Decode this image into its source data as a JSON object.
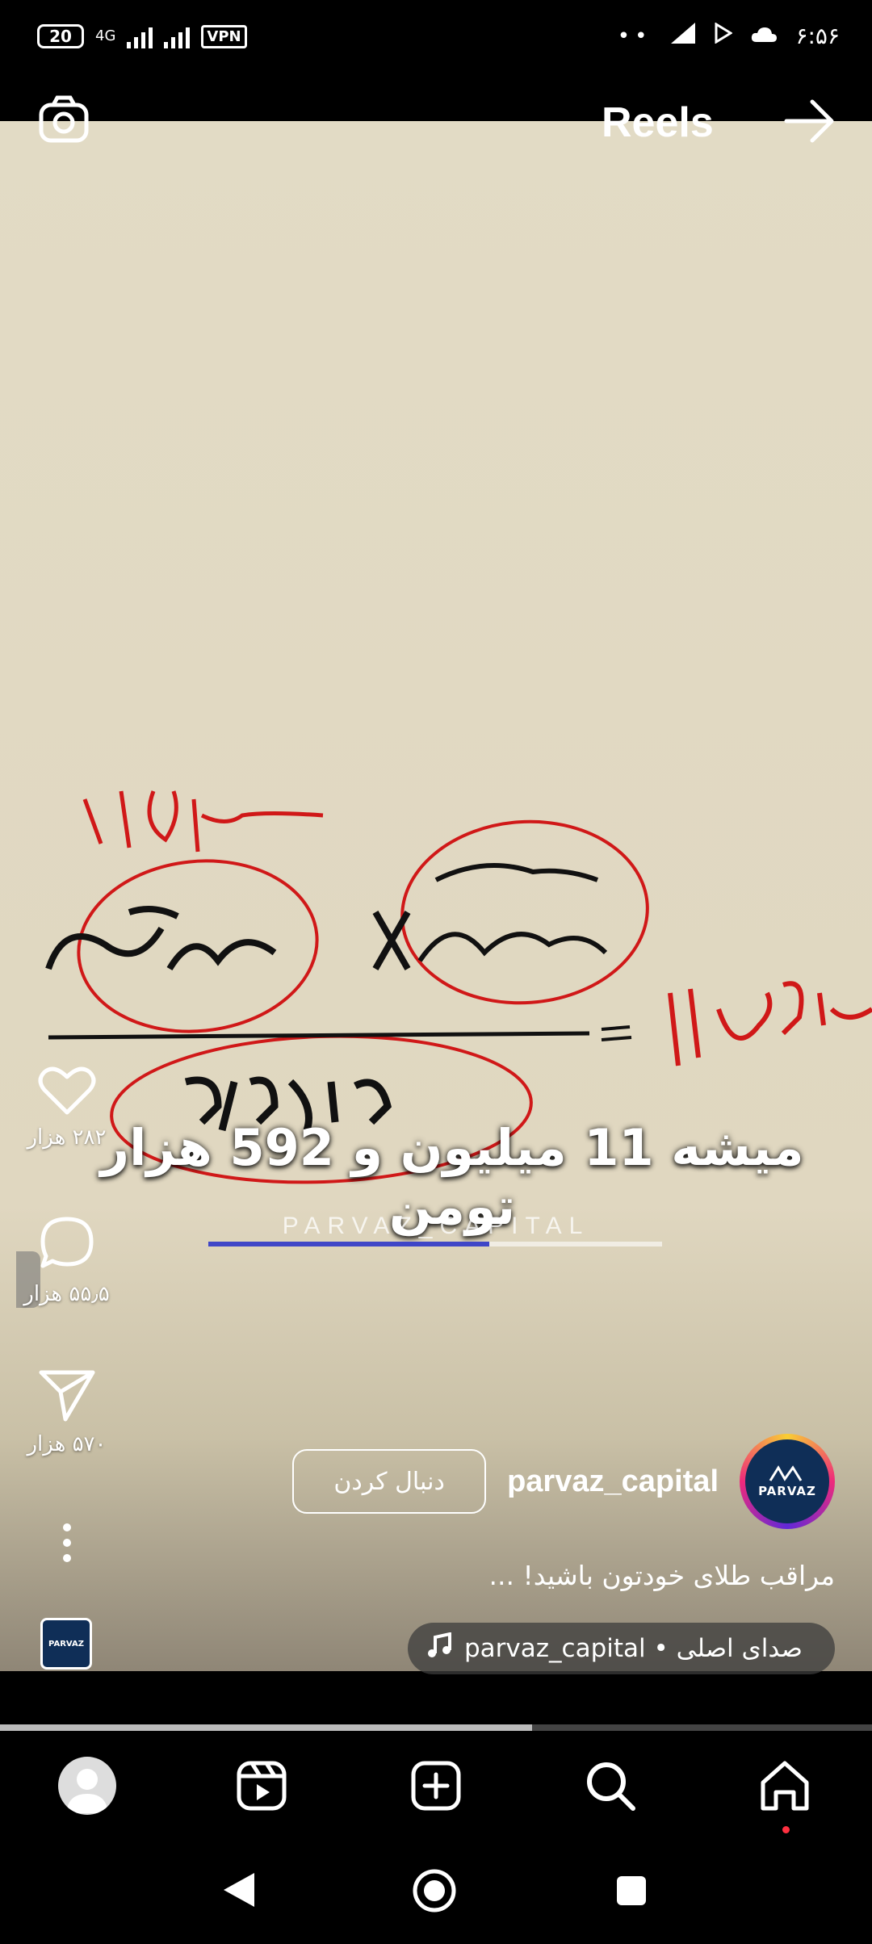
{
  "status_bar": {
    "battery": "20",
    "network": "4G",
    "vpn": "VPN",
    "time": "۶:۵۶"
  },
  "header": {
    "title": "Reels",
    "icons": [
      "camera-icon",
      "arrow-right-icon"
    ]
  },
  "video": {
    "overlay_text": "میشه 11 میلیون و 592 هزار تومن",
    "watermark": "PARVAZ_CAPITAL",
    "inner_progress": 0.62
  },
  "actions": {
    "likes": "۲۸۲ هزار",
    "comments": "۵۵٫۵ هزار",
    "shares": "۵۷۰ هزار"
  },
  "author": {
    "username": "parvaz_capital",
    "follow_label": "دنبال کردن",
    "avatar_text": "PARVAZ"
  },
  "caption": "مراقب طلای خودتون باشید! ...",
  "audio": {
    "text": "parvaz_capital • صدای اصلی"
  },
  "thumb_text": "PARVAZ",
  "playback_progress": 0.61,
  "bottom_nav": [
    "profile",
    "reels",
    "create",
    "search",
    "home"
  ],
  "colors": {
    "accent_progress": "#3f46c7",
    "notification_dot": "#ff3040"
  }
}
